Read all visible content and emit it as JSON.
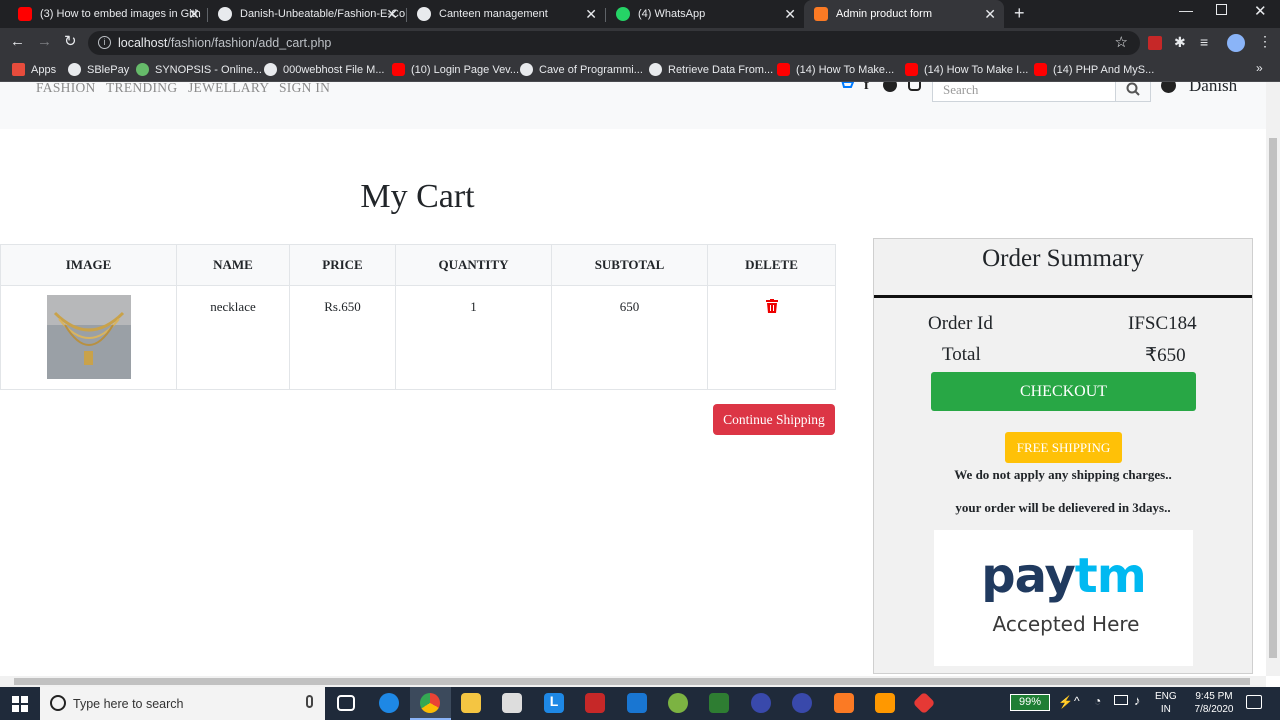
{
  "browser": {
    "tabs": [
      {
        "title": "(3) How to embed images in Gith",
        "color": "#ff0000"
      },
      {
        "title": "Danish-Unbeatable/Fashion-E-Co",
        "color": "#e8eaed"
      },
      {
        "title": "Canteen management",
        "color": "#e8eaed"
      },
      {
        "title": "(4) WhatsApp",
        "color": "#25d366"
      },
      {
        "title": "Admin product form",
        "color": "#fb7a24"
      }
    ],
    "url_host": "localhost",
    "url_path": "/fashion/fashion/add_cart.php",
    "bookmarks": [
      {
        "label": "Apps",
        "color": "#e74c3c"
      },
      {
        "label": "SBlePay",
        "color": "#e8eaed"
      },
      {
        "label": "SYNOPSIS - Online...",
        "color": "#66bb6a"
      },
      {
        "label": "000webhost File M...",
        "color": "#e8eaed"
      },
      {
        "label": "(10) Login Page Vev...",
        "color": "#ff0000"
      },
      {
        "label": "Cave of Programmi...",
        "color": "#e8eaed"
      },
      {
        "label": "Retrieve Data From...",
        "color": "#e8eaed"
      },
      {
        "label": "(14) How To Make...",
        "color": "#ff0000"
      },
      {
        "label": "(14) How To Make I...",
        "color": "#ff0000"
      },
      {
        "label": "(14) PHP And MyS...",
        "color": "#ff0000"
      }
    ]
  },
  "site": {
    "nav": [
      "FASHION",
      "TRENDING",
      "JEWELLARY",
      "SIGN IN"
    ],
    "search_placeholder": "Search",
    "user": "Danish"
  },
  "cart": {
    "title": "My Cart",
    "headers": [
      "IMAGE",
      "NAME",
      "PRICE",
      "QUANTITY",
      "SUBTOTAL",
      "DELETE"
    ],
    "rows": [
      {
        "name": "necklace",
        "price": "Rs.650",
        "quantity": "1",
        "subtotal": "650"
      }
    ],
    "continue_label": "Continue Shipping"
  },
  "summary": {
    "title": "Order Summary",
    "order_id_label": "Order Id",
    "order_id": "IFSC184",
    "total_label": "Total",
    "total": "₹650",
    "checkout_label": "CHECKOUT",
    "free_shipping_label": "FREE SHIPPING",
    "note1": "We do not apply any shipping charges..",
    "note2": "your order will be delievered in 3days..",
    "paytm_brand": "paytm",
    "paytm_caption": "Accepted Here"
  },
  "taskbar": {
    "search_placeholder": "Type here to search",
    "battery": "99%",
    "lang1": "ENG",
    "lang2": "IN",
    "time": "9:45 PM",
    "date": "7/8/2020"
  }
}
